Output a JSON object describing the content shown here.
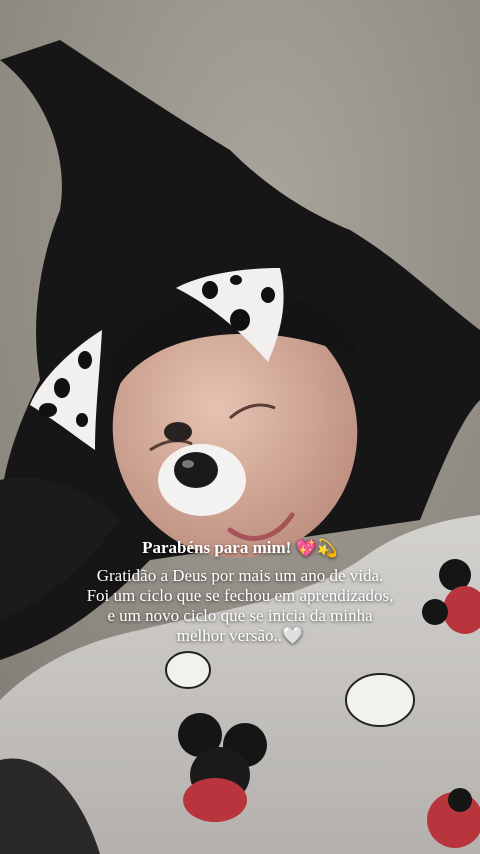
{
  "story": {
    "title": "Parabéns para mim!",
    "title_emojis": "💖💫",
    "lines": [
      "Gratidão a Deus por mais um ano de vida.",
      "Foi um ciclo que se fechou em aprendizados,",
      "e um novo ciclo que se inicia da minha",
      "melhor versão..🤍"
    ]
  },
  "photo": {
    "subject": "selfie-with-dalmatian-dog-filter",
    "colors": {
      "ground": "#9b968e",
      "hair": "#171717",
      "skin": "#d9b3a0",
      "shirt": "#c9c7c3",
      "mickey_red": "#b8353d"
    }
  }
}
